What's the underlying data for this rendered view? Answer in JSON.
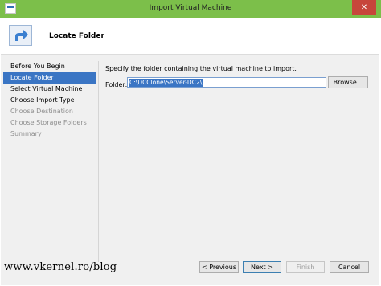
{
  "window": {
    "title": "Import Virtual Machine",
    "close_glyph": "✕",
    "accent_color": "#7cbf4a"
  },
  "header": {
    "title": "Locate Folder",
    "icon": "import-arrow-icon"
  },
  "nav": {
    "items": [
      {
        "label": "Before You Begin",
        "state": "normal"
      },
      {
        "label": "Locate Folder",
        "state": "selected"
      },
      {
        "label": "Select Virtual Machine",
        "state": "normal"
      },
      {
        "label": "Choose Import Type",
        "state": "normal"
      },
      {
        "label": "Choose Destination",
        "state": "disabled"
      },
      {
        "label": "Choose Storage Folders",
        "state": "disabled"
      },
      {
        "label": "Summary",
        "state": "disabled"
      }
    ]
  },
  "main": {
    "instruction": "Specify the folder containing the virtual machine to import.",
    "folder_label": "Folder:",
    "folder_value": "C:\\DCClone\\Server-DC2\\",
    "browse_label": "Browse..."
  },
  "footer": {
    "previous_label": "< Previous",
    "next_label": "Next >",
    "finish_label": "Finish",
    "cancel_label": "Cancel"
  },
  "watermark": "www.vkernel.ro/blog"
}
